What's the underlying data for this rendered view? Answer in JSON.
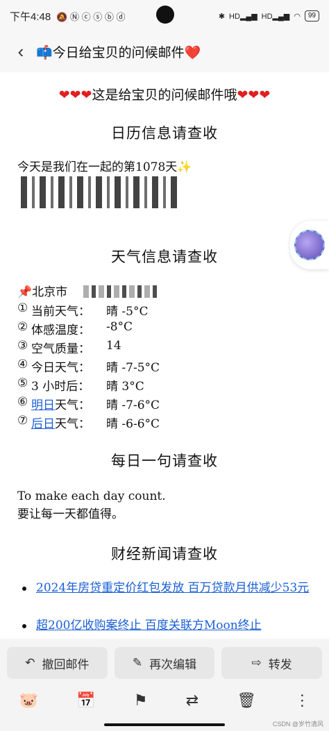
{
  "status_bar": {
    "time": "下午4:48",
    "battery": "99",
    "net1": "HD",
    "net2": "HD"
  },
  "header": {
    "title": "📫今日给宝贝的问候邮件❤️"
  },
  "email": {
    "banner": "这是给宝贝的问候邮件哦",
    "calendar": {
      "title": "日历信息请查收",
      "days_line": "今天是我们在一起的第1078天✨"
    },
    "weather": {
      "title": "天气信息请查收",
      "city": "📌北京市",
      "rows": [
        {
          "num": "①",
          "label": "当前天气：",
          "value": "晴 -5°C"
        },
        {
          "num": "②",
          "label": "体感温度：",
          "value": "-8°C"
        },
        {
          "num": "③",
          "label": "空气质量：",
          "value": "14"
        },
        {
          "num": "④",
          "label": "今日天气：",
          "value": "晴 -7-5°C"
        },
        {
          "num": "⑤",
          "label": "3 小时后：",
          "value": "晴 3°C"
        },
        {
          "num": "⑥",
          "label_link": "明日",
          "label_rest": "天气：",
          "value": "晴 -7-6°C"
        },
        {
          "num": "⑦",
          "label_link": "后日",
          "label_rest": "天气：",
          "value": "晴 -6-6°C"
        }
      ]
    },
    "quote": {
      "title": "每日一句请查收",
      "en": "To make each day count.",
      "zh": "要让每一天都值得。"
    },
    "news": {
      "title": "财经新闻请查收",
      "items": [
        "2024年房贷重定价红包发放 百万贷款月供减少53元",
        "超200亿收购案终止 百度关联方Moon终止"
      ]
    }
  },
  "actions": {
    "recall": "撤回邮件",
    "reedit": "再次编辑",
    "forward": "转发"
  },
  "toolbar_icons": [
    "pig-icon",
    "calendar-add-icon",
    "flag-icon",
    "move-folder-icon",
    "trash-icon",
    "more-icon"
  ],
  "watermark": "CSDN @岁竹清风"
}
